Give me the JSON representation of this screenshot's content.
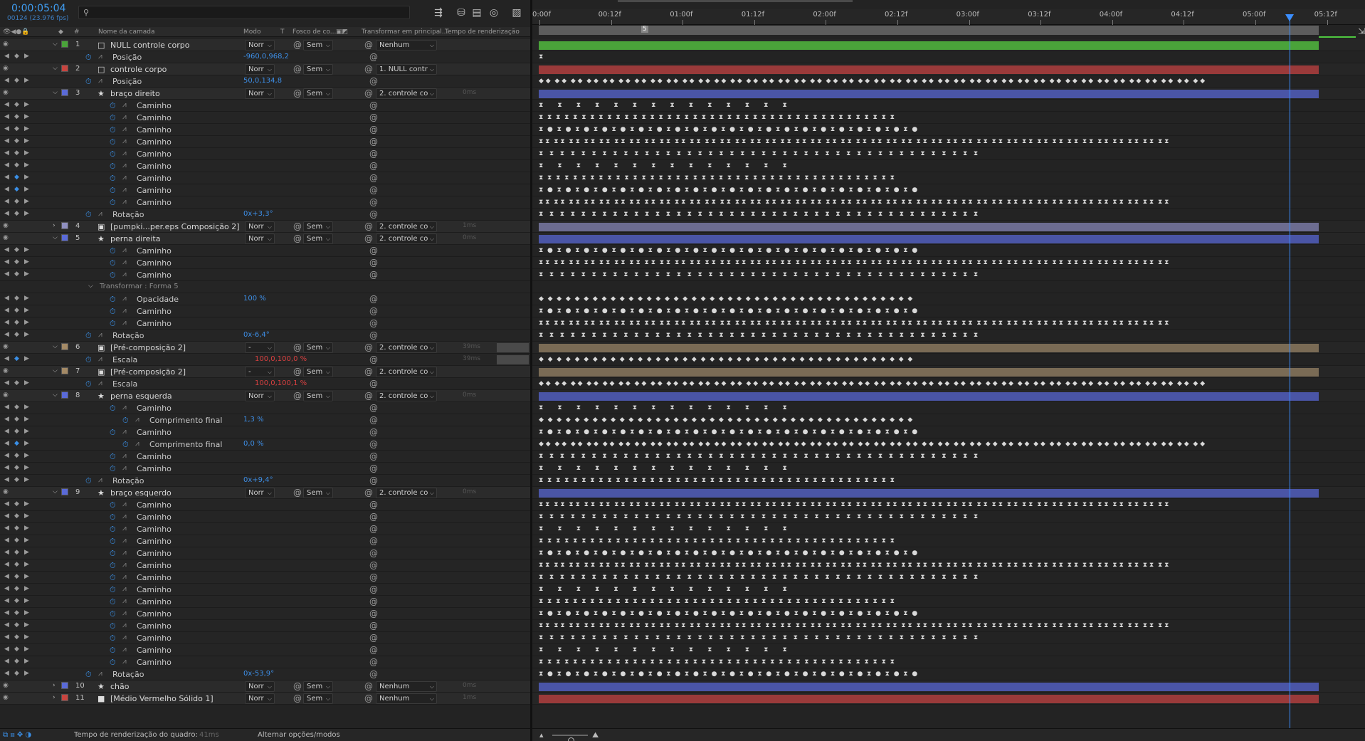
{
  "composition": {
    "timecode": "0:00:05:04",
    "frame_info": "00124 (23.976 fps)",
    "search_placeholder": ""
  },
  "icons": {
    "search": "search-icon",
    "toolbar": [
      "flowchart-icon",
      "shy-icon",
      "frame-blend-icon",
      "motion-blur-icon",
      "graph-editor-icon"
    ]
  },
  "columns": {
    "hash": "#",
    "name": "Nome da camada",
    "mode": "Modo",
    "t": "T",
    "matte": "Fosco de co...",
    "transform": "Transformar em principal...",
    "render": "Tempo de renderização"
  },
  "colors": {
    "accent": "#3b8eff",
    "green": "#4aa33a",
    "red": "#c8443f",
    "blue": "#5a6ad8",
    "tan": "#a48a66",
    "lavender": "#8f8fbf"
  },
  "rows": [
    {
      "kind": "layer",
      "num": "1",
      "label_color": "#4aa33a",
      "type": "□",
      "name": "NULL controle corpo",
      "mode": "Norr",
      "matte": "Sem",
      "parent": "Nenhum",
      "render": "",
      "eye": "true",
      "expand": "v"
    },
    {
      "kind": "prop",
      "name": "Posição",
      "value": "-960,0,968,2",
      "indent": 1,
      "stopwatch": true,
      "graph": true
    },
    {
      "kind": "layer",
      "num": "2",
      "label_color": "#c8443f",
      "type": "□",
      "name": "controle corpo",
      "mode": "Norr",
      "matte": "Sem",
      "parent": "1. NULL contr",
      "render": "",
      "eye": "true",
      "expand": "v"
    },
    {
      "kind": "prop",
      "name": "Posição",
      "value": "50,0,134,8",
      "indent": 1,
      "stopwatch": true,
      "graph": true
    },
    {
      "kind": "layer",
      "num": "3",
      "label_color": "#5a6ad8",
      "type": "★",
      "name": "braço direito",
      "mode": "Norr",
      "matte": "Sem",
      "parent": "2. controle co",
      "render": "0ms",
      "eye": "true",
      "expand": "v"
    },
    {
      "kind": "prop",
      "name": "Caminho",
      "value": "",
      "indent": 2
    },
    {
      "kind": "prop",
      "name": "Caminho",
      "value": "",
      "indent": 2
    },
    {
      "kind": "prop",
      "name": "Caminho",
      "value": "",
      "indent": 2
    },
    {
      "kind": "prop",
      "name": "Caminho",
      "value": "",
      "indent": 2
    },
    {
      "kind": "prop",
      "name": "Caminho",
      "value": "",
      "indent": 2
    },
    {
      "kind": "prop",
      "name": "Caminho",
      "value": "",
      "indent": 2
    },
    {
      "kind": "prop",
      "name": "Caminho",
      "value": "",
      "indent": 2,
      "kfactive": true
    },
    {
      "kind": "prop",
      "name": "Caminho",
      "value": "",
      "indent": 2,
      "kfactive": true
    },
    {
      "kind": "prop",
      "name": "Caminho",
      "value": "",
      "indent": 2
    },
    {
      "kind": "prop",
      "name": "Rotação",
      "value": "0x+3,3°",
      "indent": 1
    },
    {
      "kind": "layer",
      "num": "4",
      "label_color": "#8f8fbf",
      "type": "▣",
      "name": "[pumpki...per.eps Composição 2]",
      "mode": "Norr",
      "matte": "Sem",
      "parent": "2. controle co",
      "render": "1ms",
      "eye": "true",
      "expand": ">"
    },
    {
      "kind": "layer",
      "num": "5",
      "label_color": "#5a6ad8",
      "type": "★",
      "name": "perna direita",
      "mode": "Norr",
      "matte": "Sem",
      "parent": "2. controle co",
      "render": "0ms",
      "eye": "true",
      "expand": "v"
    },
    {
      "kind": "prop",
      "name": "Caminho",
      "value": "",
      "indent": 2
    },
    {
      "kind": "prop",
      "name": "Caminho",
      "value": "",
      "indent": 2
    },
    {
      "kind": "prop",
      "name": "Caminho",
      "value": "",
      "indent": 2
    },
    {
      "kind": "group",
      "name": "Transformar : Forma 5",
      "value": "",
      "indent": 1
    },
    {
      "kind": "prop",
      "name": "Opacidade",
      "value": "100 %",
      "indent": 2
    },
    {
      "kind": "prop",
      "name": "Caminho",
      "value": "",
      "indent": 2
    },
    {
      "kind": "prop",
      "name": "Caminho",
      "value": "",
      "indent": 2
    },
    {
      "kind": "prop",
      "name": "Rotação",
      "value": "0x-6,4°",
      "indent": 1
    },
    {
      "kind": "layer",
      "num": "6",
      "label_color": "#a48a66",
      "type": "▣",
      "name": "[Pré-composição 2]",
      "mode": "-",
      "matte": "Sem",
      "parent": "2. controle co",
      "render": "39ms",
      "eye": "true",
      "expand": "v",
      "bar": true
    },
    {
      "kind": "prop",
      "name": "Escala",
      "value": "100,0,100,0 %",
      "indent": 1,
      "red": true,
      "kfactive": true,
      "render": "39ms",
      "bar": true
    },
    {
      "kind": "layer",
      "num": "7",
      "label_color": "#a48a66",
      "type": "▣",
      "name": "[Pré-composição 2]",
      "mode": "-",
      "matte": "Sem",
      "parent": "2. controle co",
      "render": "",
      "eye": "true",
      "expand": "v"
    },
    {
      "kind": "prop",
      "name": "Escala",
      "value": "100,0,100,1 %",
      "indent": 1,
      "red": true
    },
    {
      "kind": "layer",
      "num": "8",
      "label_color": "#5a6ad8",
      "type": "★",
      "name": "perna esquerda",
      "mode": "Norr",
      "matte": "Sem",
      "parent": "2. controle co",
      "render": "0ms",
      "eye": "true",
      "expand": "v"
    },
    {
      "kind": "prop",
      "name": "Caminho",
      "value": "",
      "indent": 2
    },
    {
      "kind": "prop",
      "name": "Comprimento final",
      "value": "1,3 %",
      "indent": 3
    },
    {
      "kind": "prop",
      "name": "Caminho",
      "value": "",
      "indent": 2
    },
    {
      "kind": "prop",
      "name": "Comprimento final",
      "value": "0,0 %",
      "indent": 3,
      "kfactive": true
    },
    {
      "kind": "prop",
      "name": "Caminho",
      "value": "",
      "indent": 2
    },
    {
      "kind": "prop",
      "name": "Caminho",
      "value": "",
      "indent": 2
    },
    {
      "kind": "prop",
      "name": "Rotação",
      "value": "0x+9,4°",
      "indent": 1
    },
    {
      "kind": "layer",
      "num": "9",
      "label_color": "#5a6ad8",
      "type": "★",
      "name": "braço esquerdo",
      "mode": "Norr",
      "matte": "Sem",
      "parent": "2. controle co",
      "render": "0ms",
      "eye": "true",
      "expand": "v"
    },
    {
      "kind": "prop",
      "name": "Caminho",
      "value": "",
      "indent": 2
    },
    {
      "kind": "prop",
      "name": "Caminho",
      "value": "",
      "indent": 2
    },
    {
      "kind": "prop",
      "name": "Caminho",
      "value": "",
      "indent": 2
    },
    {
      "kind": "prop",
      "name": "Caminho",
      "value": "",
      "indent": 2
    },
    {
      "kind": "prop",
      "name": "Caminho",
      "value": "",
      "indent": 2
    },
    {
      "kind": "prop",
      "name": "Caminho",
      "value": "",
      "indent": 2
    },
    {
      "kind": "prop",
      "name": "Caminho",
      "value": "",
      "indent": 2
    },
    {
      "kind": "prop",
      "name": "Caminho",
      "value": "",
      "indent": 2
    },
    {
      "kind": "prop",
      "name": "Caminho",
      "value": "",
      "indent": 2
    },
    {
      "kind": "prop",
      "name": "Caminho",
      "value": "",
      "indent": 2
    },
    {
      "kind": "prop",
      "name": "Caminho",
      "value": "",
      "indent": 2
    },
    {
      "kind": "prop",
      "name": "Caminho",
      "value": "",
      "indent": 2
    },
    {
      "kind": "prop",
      "name": "Caminho",
      "value": "",
      "indent": 2
    },
    {
      "kind": "prop",
      "name": "Caminho",
      "value": "",
      "indent": 2
    },
    {
      "kind": "prop",
      "name": "Rotação",
      "value": "0x-53,9°",
      "indent": 1
    },
    {
      "kind": "layer",
      "num": "10",
      "label_color": "#5a6ad8",
      "type": "★",
      "name": "chão",
      "mode": "Norr",
      "matte": "Sem",
      "parent": "Nenhum",
      "render": "0ms",
      "eye": "true",
      "expand": ">"
    },
    {
      "kind": "layer",
      "num": "11",
      "label_color": "#c8443f",
      "type": "■",
      "name": "[Médio Vermelho Sólido 1]",
      "mode": "Norr",
      "matte": "Sem",
      "parent": "Nenhum",
      "render": "1ms",
      "eye": "true",
      "expand": ">"
    }
  ],
  "timeline": {
    "ticks": [
      "0:00f",
      "00:12f",
      "01:00f",
      "01:12f",
      "02:00f",
      "02:12f",
      "03:00f",
      "03:12f",
      "04:00f",
      "04:12f",
      "05:00f",
      "05:12f"
    ],
    "bar_colors": {
      "1": "#4aa33a",
      "2": "#9a3a3a",
      "3": "#4a55a6",
      "4": "#6c6c90",
      "5": "#4a55a6",
      "6": "#7a6b55",
      "7": "#7a6b55",
      "8": "#4a55a6",
      "9": "#4a55a6",
      "10": "#4a55a6",
      "11": "#9a3a3a"
    },
    "cti_marker": "5"
  },
  "footer": {
    "render_label": "Tempo de renderização do quadro:",
    "render_value": "41ms",
    "toggle_label": "Alternar opções/modos"
  }
}
